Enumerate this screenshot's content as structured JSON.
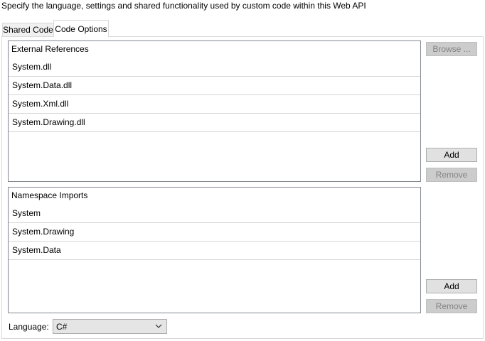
{
  "description": "Specify the language, settings and shared functionality used by custom code within this Web API",
  "tabs": [
    {
      "label": "Shared Code",
      "active": false
    },
    {
      "label": "Code Options",
      "active": true
    }
  ],
  "references": {
    "header": "External References",
    "items": [
      "System.dll",
      "System.Data.dll",
      "System.Xml.dll",
      "System.Drawing.dll"
    ],
    "browse_label": "Browse ...",
    "add_label": "Add",
    "remove_label": "Remove"
  },
  "namespaces": {
    "header": "Namespace Imports",
    "items": [
      "System",
      "System.Drawing",
      "System.Data"
    ],
    "add_label": "Add",
    "remove_label": "Remove"
  },
  "language": {
    "label": "Language:",
    "value": "C#"
  },
  "icons": {
    "dropdown": "chevron-down-icon"
  },
  "colors": {
    "disabled_button": "#cccccc",
    "disabled_text": "#838383",
    "button": "#e1e1e1"
  }
}
